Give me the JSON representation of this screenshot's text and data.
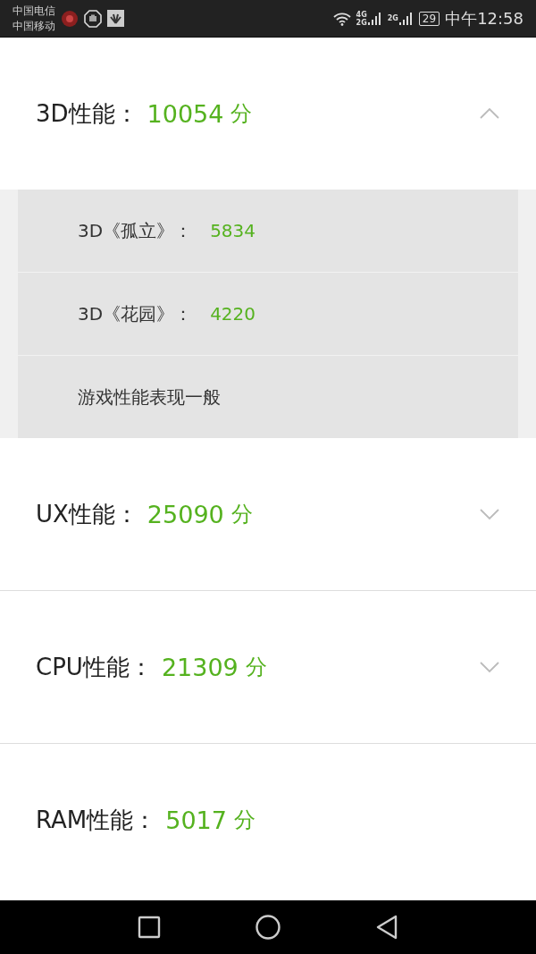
{
  "status_bar": {
    "carriers": [
      "中国电信",
      "中国移动"
    ],
    "network_labels": [
      {
        "top": "4G",
        "bottom": "2G"
      },
      {
        "top": "2G"
      }
    ],
    "battery": "29",
    "time": "中午12:58"
  },
  "sections": [
    {
      "label": "3D性能：",
      "score": "10054",
      "unit": "分",
      "toggle": true,
      "expanded": true,
      "details": [
        {
          "kind": "score",
          "label": "3D《孤立》：",
          "value": "5834"
        },
        {
          "kind": "score",
          "label": "3D《花园》：",
          "value": "4220"
        },
        {
          "kind": "note",
          "text": "游戏性能表现一般"
        }
      ]
    },
    {
      "label": "UX性能：",
      "score": "25090",
      "unit": "分",
      "toggle": true,
      "expanded": false
    },
    {
      "label": "CPU性能：",
      "score": "21309",
      "unit": "分",
      "toggle": true,
      "expanded": false
    },
    {
      "label": "RAM性能：",
      "score": "5017",
      "unit": "分",
      "toggle": false,
      "expanded": false
    }
  ]
}
